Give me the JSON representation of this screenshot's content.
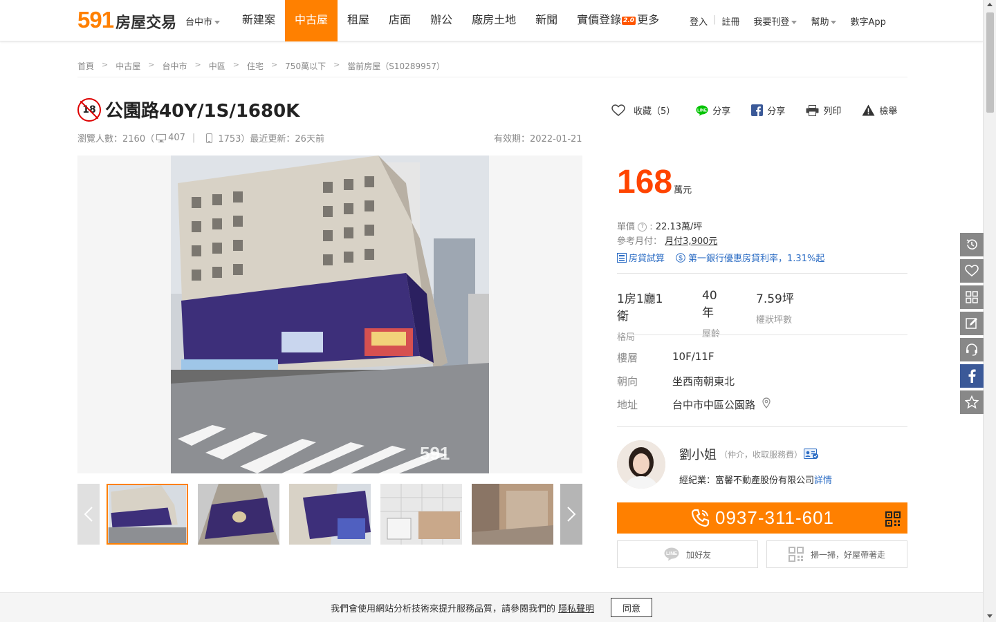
{
  "header": {
    "logo_num": "591",
    "logo_text": "房屋交易",
    "city": "台中市",
    "nav": [
      "新建案",
      "中古屋",
      "租屋",
      "店面",
      "辦公",
      "廠房土地",
      "新聞",
      "實價登錄",
      "更多"
    ],
    "nav_active": "中古屋",
    "badge": "2.0",
    "login": "登入",
    "register": "註冊",
    "post": "我要刊登",
    "help": "幫助",
    "app": "數字App"
  },
  "breadcrumb": [
    "首頁",
    "中古屋",
    "台中市",
    "中區",
    "住宅",
    "750萬以下",
    "當前房屋（S10289957）"
  ],
  "listing": {
    "age_label": "18",
    "title": "公園路40Y/1S/1680K",
    "views_label": "瀏覽人數：2160（",
    "views_pc": "407",
    "views_mobile": "1753）最近更新：26天前",
    "valid": "有效期：2022-01-21"
  },
  "actions": {
    "favorite": "收藏（5）",
    "line_share": "分享",
    "fb_share": "分享",
    "print": "列印",
    "report": "檢舉"
  },
  "price": {
    "value": "168",
    "unit": "萬元",
    "unit_price_label": "單價",
    "unit_price": "22.13萬/坪",
    "monthly_label": "參考月付：",
    "monthly": "月付3,900元",
    "loan_calc": "房貸試算",
    "bank_offer": "第一銀行優惠房貸利率，1.31%起"
  },
  "stats": [
    {
      "value": "1房1廳1衛",
      "label": "格局"
    },
    {
      "value": "40年",
      "label": "屋齡"
    },
    {
      "value": "7.59坪",
      "label": "權狀坪數"
    }
  ],
  "details": [
    {
      "label": "樓層",
      "value": "10F/11F"
    },
    {
      "label": "朝向",
      "value": "坐西南朝東北"
    },
    {
      "label": "地址",
      "value": "台中市中區公園路"
    }
  ],
  "agent": {
    "name": "劉小姐",
    "role": "（仲介，收取服務費）",
    "company_label": "經紀業：富馨不動產股份有限公司",
    "details_link": "詳情",
    "phone": "0937-311-601",
    "line_add": "加好友",
    "scan": "掃一掃，好屋帶著走"
  },
  "cookie": {
    "text": "我們會使用網站分析技術來提升服務品質，請參閱我們的",
    "link": "隱私聲明",
    "button": "同意"
  },
  "colors": {
    "brand": "#ff8000",
    "price": "#ff4400",
    "link": "#2b6cc4",
    "facebook": "#3b5998"
  }
}
